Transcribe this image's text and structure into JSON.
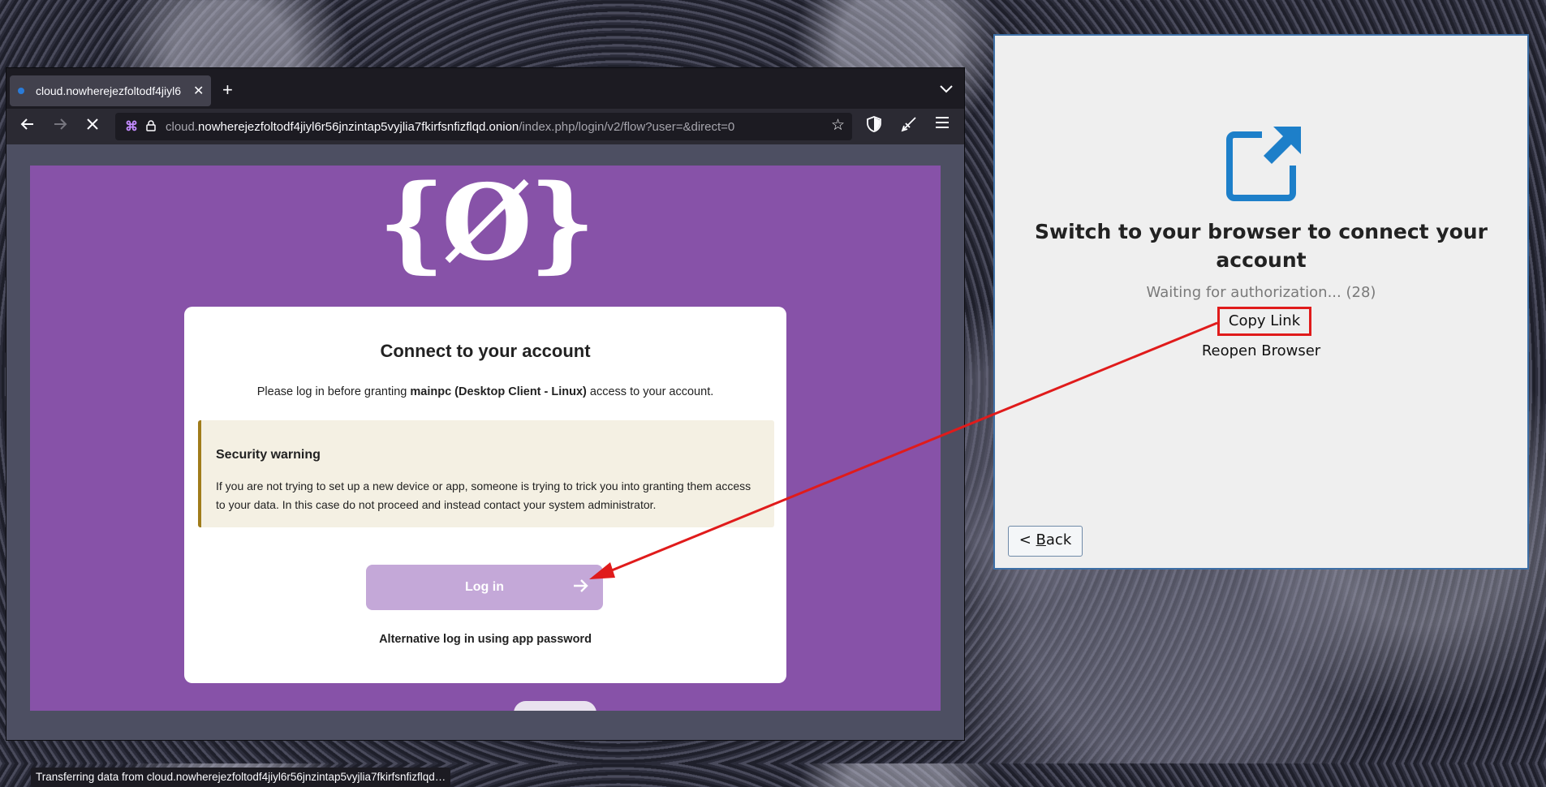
{
  "browser": {
    "tab_title": "cloud.nowherejezfoltodf4jiyl6",
    "tab_close": "✕",
    "new_tab": "+",
    "url_scheme_host_prefix": "cloud.",
    "url_host": "nowherejezfoltodf4jiyl6r56jnzintap5vyjlia7fkirfsnfizflqd.onion",
    "url_path": "/index.php/login/v2/flow?user=&direct=0",
    "status_text": "Transferring data from cloud.nowherejezfoltodf4jiyl6r56jnzintap5vyjlia7fkirfsnfizflqd…"
  },
  "page": {
    "logo_text": "{Ø}",
    "title": "Connect to your account",
    "desc_pre": "Please log in before granting ",
    "desc_client": "mainpc (Desktop Client - Linux)",
    "desc_post": " access to your account.",
    "warning_title": "Security warning",
    "warning_text": "If you are not trying to set up a new device or app, someone is trying to trick you into granting them access to your data. In this case do not proceed and instead contact your system administrator.",
    "login_label": "Log in",
    "alt_login": "Alternative log in using app password"
  },
  "dialog": {
    "title": "Switch to your browser to connect your account",
    "waiting": "Waiting for authorization... (28)",
    "copy_link": "Copy Link",
    "reopen": "Reopen Browser",
    "back_prefix": "< ",
    "back_mnemonic": "B",
    "back_rest": "ack"
  },
  "colors": {
    "page_purple": "#8752a8",
    "annotation_red": "#e01b1b",
    "dialog_icon_blue": "#1d7fc9"
  }
}
